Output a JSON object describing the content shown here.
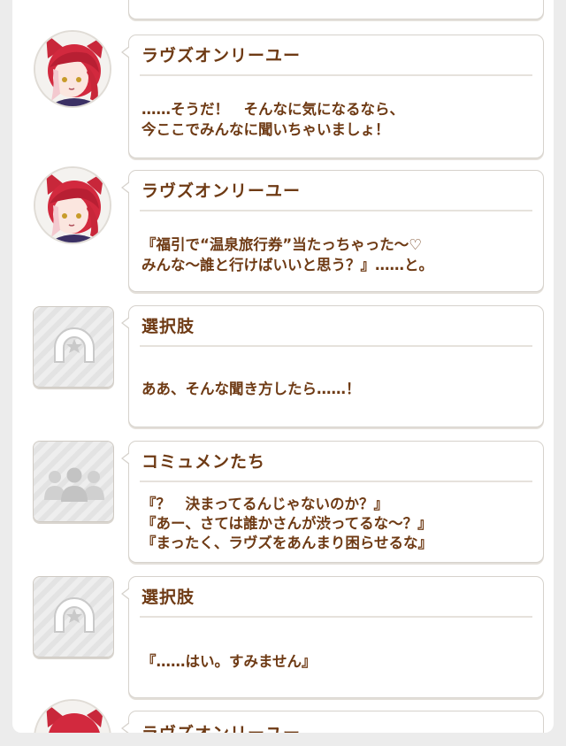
{
  "messages": [
    {
      "speaker": "",
      "lines": []
    },
    {
      "speaker": "ラヴズオンリーユー",
      "avatar": "character-portrait",
      "lines": [
        "……そうだ！　そんなに気になるなら、",
        "今ここでみんなに聞いちゃいましょ！"
      ]
    },
    {
      "speaker": "ラヴズオンリーユー",
      "avatar": "character-portrait",
      "lines": [
        "『福引で“温泉旅行券”当たっちゃった～♡",
        "みんな～誰と行けばいいと思う？』……と。"
      ]
    },
    {
      "speaker": "選択肢",
      "avatar": "horseshoe-icon",
      "lines": [
        "ああ、そんな聞き方したら……！"
      ]
    },
    {
      "speaker": "コミュメンたち",
      "avatar": "group-icon",
      "lines": [
        "『？　決まってるんじゃないのか？』",
        "『あー、さては誰かさんが渋ってるな～？』",
        "『まったく、ラヴズをあんまり困らせるな』"
      ]
    },
    {
      "speaker": "選択肢",
      "avatar": "horseshoe-icon",
      "lines": [
        "『……はい。すみません』"
      ]
    },
    {
      "speaker": "ラヴズオンリーユー",
      "avatar": "character-portrait",
      "lines": []
    }
  ],
  "colors": {
    "text": "#6e3a14",
    "border": "#d6d2cc",
    "hair": "#c8273a"
  }
}
